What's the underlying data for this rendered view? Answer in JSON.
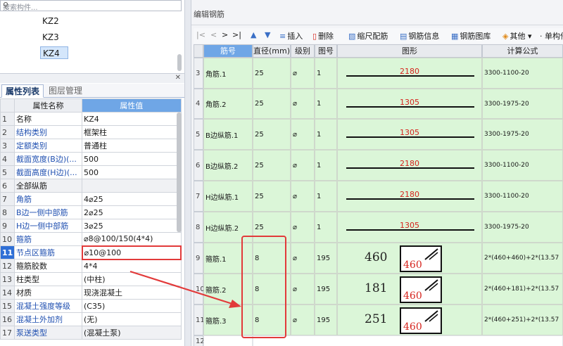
{
  "left": {
    "search_placeholder": "搜索构件...",
    "tree_items": [
      "KZ2",
      "KZ3",
      "KZ4"
    ],
    "tabs": [
      "属性列表",
      "图层管理"
    ],
    "prop_headers": [
      "属性名称",
      "属性值"
    ],
    "props": [
      {
        "n": "1",
        "name": "名称",
        "value": "KZ4"
      },
      {
        "n": "2",
        "name": "结构类别",
        "value": "框架柱"
      },
      {
        "n": "3",
        "name": "定额类别",
        "value": "普通柱"
      },
      {
        "n": "4",
        "name": "截面宽度(B边)(...",
        "value": "500"
      },
      {
        "n": "5",
        "name": "截面高度(H边)(...",
        "value": "500"
      },
      {
        "n": "6",
        "name": "全部纵筋",
        "value": ""
      },
      {
        "n": "7",
        "name": "角筋",
        "value": "4⌀25"
      },
      {
        "n": "8",
        "name": "B边一侧中部筋",
        "value": "2⌀25"
      },
      {
        "n": "9",
        "name": "H边一侧中部筋",
        "value": "3⌀25"
      },
      {
        "n": "10",
        "name": "箍筋",
        "value": "⌀8@100/150(4*4)"
      },
      {
        "n": "11",
        "name": "节点区箍筋",
        "value": "⌀10@100"
      },
      {
        "n": "12",
        "name": "箍筋胶数",
        "value": "4*4"
      },
      {
        "n": "13",
        "name": "柱类型",
        "value": "(中柱)"
      },
      {
        "n": "14",
        "name": "材质",
        "value": "现浇混凝土"
      },
      {
        "n": "15",
        "name": "混凝土强度等级",
        "value": "(C35)"
      },
      {
        "n": "16",
        "name": "混凝土外加剂",
        "value": "(无)"
      },
      {
        "n": "17",
        "name": "泵送类型",
        "value": "(混凝土泵)"
      }
    ]
  },
  "right": {
    "title": "编辑钢筋",
    "toolbar": {
      "insert": "插入",
      "delete": "删除",
      "scale": "缩尺配筋",
      "info": "钢筋信息",
      "library": "钢筋图库",
      "other": "其他",
      "unit": "单构件"
    },
    "headers": [
      "筋号",
      "直径(mm)",
      "级别",
      "图号",
      "图形",
      "计算公式"
    ],
    "rows": [
      {
        "n": "3",
        "name": "角筋.1",
        "dia": "25",
        "grade": "⌀",
        "fig": "1",
        "len": "2180",
        "formula": "3300-1100-20"
      },
      {
        "n": "4",
        "name": "角筋.2",
        "dia": "25",
        "grade": "⌀",
        "fig": "1",
        "len": "1305",
        "formula": "3300-1975-20"
      },
      {
        "n": "5",
        "name": "B边纵筋.1",
        "dia": "25",
        "grade": "⌀",
        "fig": "1",
        "len": "1305",
        "formula": "3300-1975-20"
      },
      {
        "n": "6",
        "name": "B边纵筋.2",
        "dia": "25",
        "grade": "⌀",
        "fig": "1",
        "len": "2180",
        "formula": "3300-1100-20"
      },
      {
        "n": "7",
        "name": "H边纵筋.1",
        "dia": "25",
        "grade": "⌀",
        "fig": "1",
        "len": "2180",
        "formula": "3300-1100-20"
      },
      {
        "n": "8",
        "name": "H边纵筋.2",
        "dia": "25",
        "grade": "⌀",
        "fig": "1",
        "len": "1305",
        "formula": "3300-1975-20"
      },
      {
        "n": "9",
        "name": "箍筋.1",
        "dia": "8",
        "grade": "⌀",
        "fig": "195",
        "side": "460",
        "inner": "460",
        "formula": "2*(460+460)+2*(13.57"
      },
      {
        "n": "10",
        "name": "箍筋.2",
        "dia": "8",
        "grade": "⌀",
        "fig": "195",
        "side": "181",
        "inner": "460",
        "formula": "2*(460+181)+2*(13.57"
      },
      {
        "n": "11",
        "name": "箍筋.3",
        "dia": "8",
        "grade": "⌀",
        "fig": "195",
        "side": "251",
        "inner": "460",
        "formula": "2*(460+251)+2*(13.57"
      },
      {
        "n": "12",
        "name": "",
        "dia": "",
        "grade": "",
        "fig": "",
        "formula": ""
      }
    ]
  },
  "colors": {
    "accent": "#6fa6e6",
    "highlight": "#e23a3a",
    "row_bg": "#dbf6d8"
  }
}
